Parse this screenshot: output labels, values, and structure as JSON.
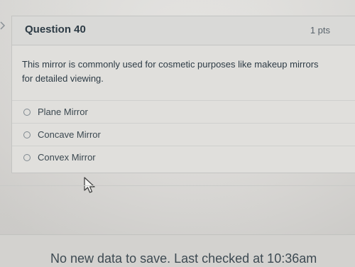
{
  "question": {
    "title": "Question 40",
    "points": "1 pts",
    "text": "This mirror is commonly used for cosmetic purposes like makeup mirrors for detailed viewing.",
    "options": [
      {
        "label": "Plane Mirror",
        "selected": false
      },
      {
        "label": "Concave Mirror",
        "selected": false
      },
      {
        "label": "Convex Mirror",
        "selected": false
      }
    ]
  },
  "footer": {
    "status": "No new data to save. Last checked at 10:36am"
  },
  "icons": {
    "side": "chevron-right-icon",
    "pointer": "mouse-cursor-icon",
    "radio": "radio-button-icon"
  },
  "colors": {
    "text": "#2d3b45",
    "border": "#c3c4c2",
    "header_bg": "#d9d9d7"
  }
}
